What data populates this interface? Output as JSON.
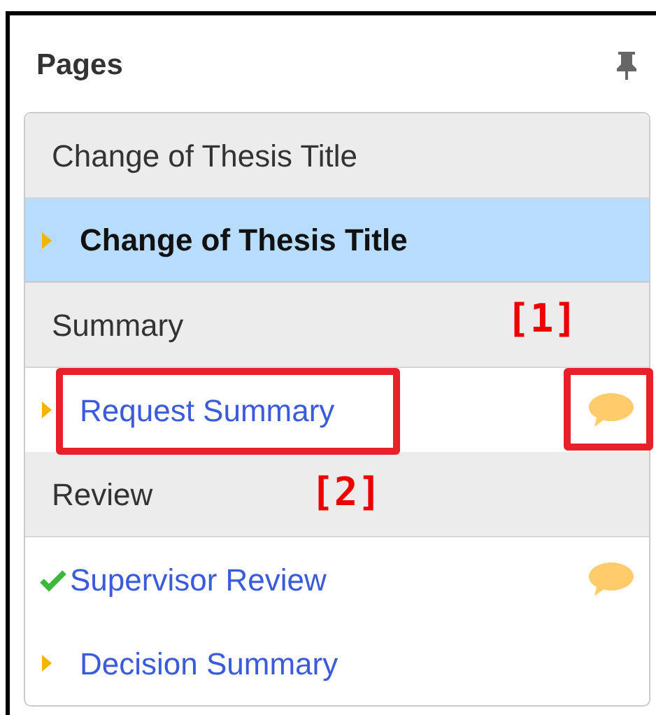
{
  "panel": {
    "title": "Pages",
    "pinned": true
  },
  "items": [
    {
      "kind": "section",
      "label": "Change of Thesis Title"
    },
    {
      "kind": "page",
      "label": "Change of Thesis Title",
      "completed": false,
      "selected": true,
      "comment": false
    },
    {
      "kind": "section",
      "label": "Summary"
    },
    {
      "kind": "page",
      "label": "Request Summary",
      "completed": false,
      "selected": false,
      "comment": true,
      "annotations": [
        {
          "kind": "text",
          "label": "[2]"
        },
        {
          "kind": "comment",
          "label": "[1]"
        }
      ]
    },
    {
      "kind": "section",
      "label": "Review"
    },
    {
      "kind": "page",
      "label": "Supervisor Review",
      "completed": true,
      "selected": false,
      "comment": true
    },
    {
      "kind": "page",
      "label": "Decision Summary",
      "completed": false,
      "selected": false,
      "comment": false
    }
  ]
}
